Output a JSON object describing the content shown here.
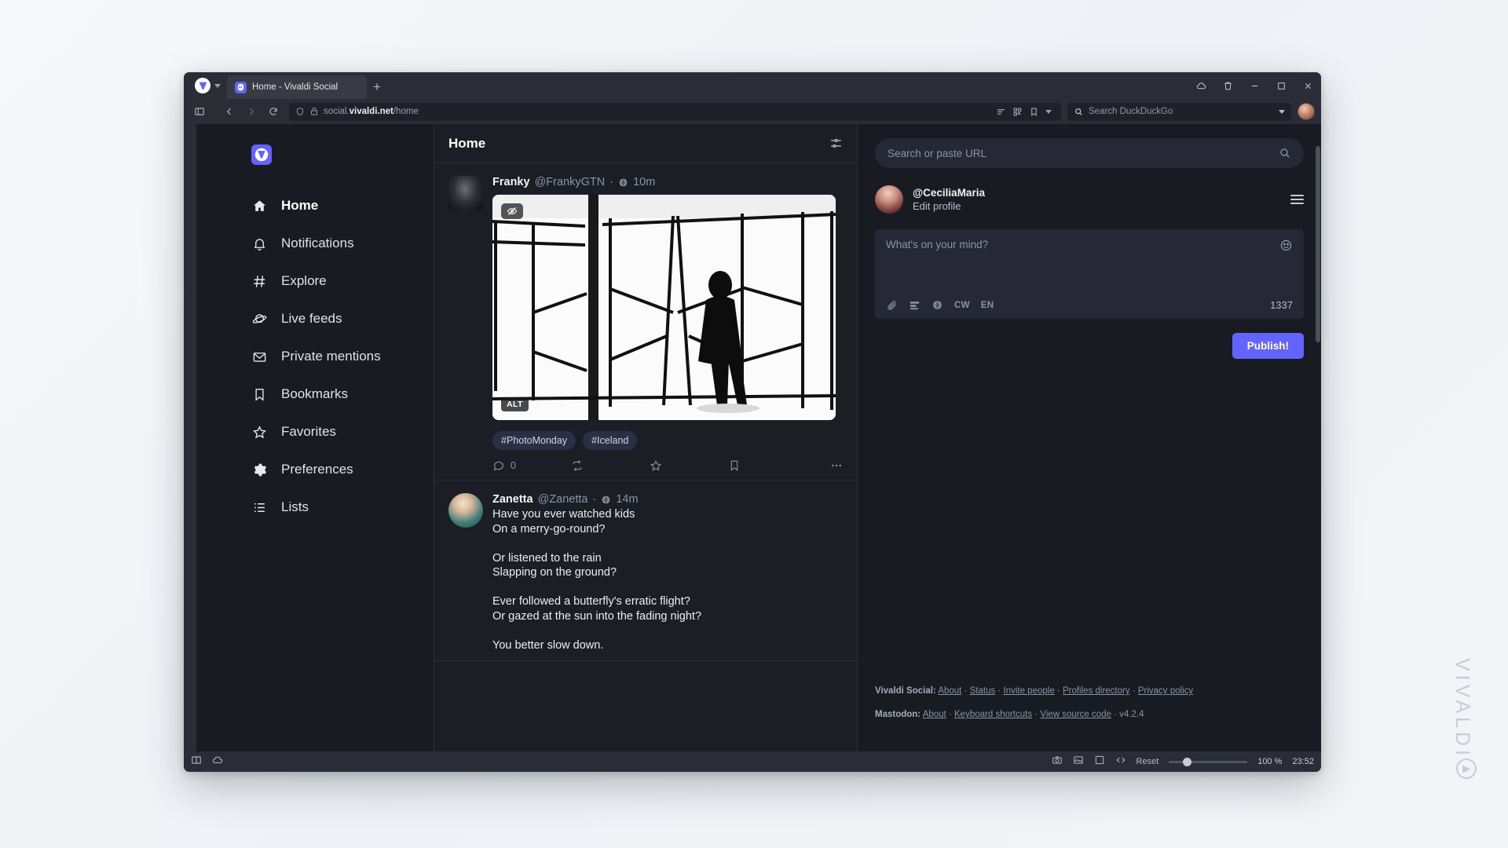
{
  "browser": {
    "tab": {
      "title": "Home - Vivaldi Social",
      "favicon": "mastodon-icon"
    },
    "new_tab_label": "+",
    "window_controls": {
      "minimize": "minimize-icon",
      "maximize": "maximize-icon",
      "close": "close-icon"
    },
    "toolbar_right_icons": [
      "cloud-icon",
      "trash-icon"
    ],
    "nav": {
      "back": "back-icon",
      "forward": "forward-icon",
      "reload": "reload-icon"
    },
    "url": {
      "prefix": "social.",
      "domain": "vivaldi.net",
      "path": "/home",
      "full": "social.vivaldi.net/home"
    },
    "url_icons": [
      "reader-view-icon",
      "qr-code-icon",
      "bookmark-icon",
      "chevron-down-icon"
    ],
    "search": {
      "placeholder": "Search DuckDuckGo",
      "engine_badge": "Q"
    },
    "panel_toggle": "panel-toggle-icon",
    "profile_avatar": "user-avatar"
  },
  "statusbar": {
    "left_icons": [
      "tiling-icon",
      "cloud-icon"
    ],
    "right_icons": [
      "capture-icon",
      "image-toggle-icon",
      "page-actions-icon",
      "developer-tools-icon"
    ],
    "reset_label": "Reset",
    "zoom_level": "100 %",
    "clock": "23:52"
  },
  "sidebar": {
    "logo": "vivaldi-social-logo",
    "items": [
      {
        "label": "Home",
        "icon": "home-icon",
        "active": true
      },
      {
        "label": "Notifications",
        "icon": "bell-icon",
        "active": false
      },
      {
        "label": "Explore",
        "icon": "hash-icon",
        "active": false
      },
      {
        "label": "Live feeds",
        "icon": "planet-icon",
        "active": false
      },
      {
        "label": "Private mentions",
        "icon": "envelope-icon",
        "active": false
      },
      {
        "label": "Bookmarks",
        "icon": "bookmark-icon",
        "active": false
      },
      {
        "label": "Favorites",
        "icon": "star-icon",
        "active": false
      },
      {
        "label": "Preferences",
        "icon": "gear-icon",
        "active": false
      },
      {
        "label": "Lists",
        "icon": "list-icon",
        "active": false
      }
    ]
  },
  "column": {
    "title": "Home",
    "settings_icon": "sliders-icon",
    "statuses": [
      {
        "display_name": "Franky",
        "handle": "@FrankyGTN",
        "separator": "·",
        "visibility_icon": "globe-icon",
        "time": "10m",
        "media": {
          "alt_badge": "ALT",
          "hide_badge": "eye-slash-icon",
          "description": "black and white photo of a silhouetted person standing by large angular glass windows"
        },
        "tags": [
          "#PhotoMonday",
          "#Iceland"
        ],
        "actions": {
          "reply_icon": "comment-icon",
          "reply_count": "0",
          "boost_icon": "boost-icon",
          "favorite_icon": "star-icon",
          "bookmark_icon": "bookmark-icon",
          "more_icon": "ellipsis-icon"
        }
      },
      {
        "display_name": "Zanetta",
        "handle": "@Zanetta",
        "separator": "·",
        "visibility_icon": "globe-icon",
        "time": "14m",
        "lines": [
          "Have you ever watched kids",
          "On a merry-go-round?",
          "",
          "Or listened to the rain",
          "Slapping on the ground?",
          "",
          "Ever followed a butterfly's erratic flight?",
          "Or gazed at the sun into the fading night?",
          "",
          "You better slow down."
        ]
      }
    ]
  },
  "right_panel": {
    "search_placeholder": "Search or paste URL",
    "search_icon": "magnifier-icon",
    "profile": {
      "handle": "@CeciliaMaria",
      "edit_label": "Edit profile",
      "menu_icon": "hamburger-icon",
      "avatar": "cecilia-avatar"
    },
    "composer": {
      "placeholder": "What's on your mind?",
      "emoji_icon": "smiley-icon",
      "tools": [
        {
          "name": "attach-icon",
          "label": ""
        },
        {
          "name": "poll-icon",
          "label": ""
        },
        {
          "name": "visibility-globe-icon",
          "label": ""
        },
        {
          "name": "content-warning-toggle",
          "label": "CW"
        },
        {
          "name": "language-toggle",
          "label": "EN"
        }
      ],
      "char_count": "1337",
      "publish_label": "Publish!"
    },
    "footer": {
      "vivaldi_prefix": "Vivaldi Social:",
      "vivaldi_links": [
        "About",
        "Status",
        "Invite people",
        "Profiles directory",
        "Privacy policy"
      ],
      "mastodon_prefix": "Mastodon:",
      "mastodon_links": [
        "About",
        "Keyboard shortcuts",
        "View source code"
      ],
      "version": "v4.2.4",
      "sep": "·"
    }
  },
  "desktop": {
    "wordmark": "VIVALDI"
  },
  "colors": {
    "accent": "#6364ff",
    "window_chrome": "#2b2d36",
    "page_bg": "#191b22",
    "column_bg": "#1c1e26",
    "text_muted": "#8d93a2"
  }
}
